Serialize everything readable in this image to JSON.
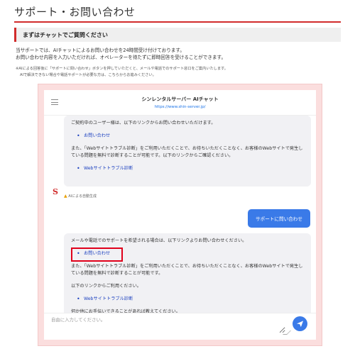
{
  "page": {
    "title": "サポート・お問い合わせ",
    "section_heading": "まずはチャットでご質問ください",
    "intro_line1": "当サポートでは、AIチャットによるお問い合わせを24時間受け付けております。",
    "intro_line2": "お問い合わせ内容を入力いただければ、オペレーターを待たずに即時回答を受けることができます。",
    "note_line1": "※AIによる回答後に「サポートに問い合わせ」ボタンを押していただくと、メールや電話でのサポート窓口をご案内いたします。",
    "note_line2": "AIで解決できない場合や電話サポートが必要な方は、こちらからお進みください。"
  },
  "chat": {
    "title": "シンレンタルサーバー AIチャット",
    "url": "https://www.shin-server.jp/",
    "message1": {
      "p1": "ご契約中のユーザー様は、以下のリンクからお問い合わせいただけます。",
      "link1": "お問い合わせ",
      "p2": "また、「Webサイトトラブル診断」をご利用いただくことで、お待ちいただくことなく、お客様のWebサイトで発生している問題を無料で診断することが可能です。以下のリンクからご確認ください。",
      "link2": "Webサイトトラブル診断"
    },
    "ai_note": "AIによる自動生成",
    "ai_note_icon": "warning-icon",
    "user_message": "サポートに問い合わせ",
    "message2": {
      "p1": "メールや電話でのサポートを希望される場合は、以下リンクよりお問い合わせください。",
      "link1": "お問い合わせ",
      "p2": "また、「Webサイトトラブル診断」をご利用いただくことで、お待ちいただくことなく、お客様のWebサイトで発生している問題を無料で診断することが可能です。",
      "p3": "以下のリンクからご利用ください。",
      "link2": "Webサイトトラブル診断",
      "p4": "何か他にお手伝いできることがあれば教えてください。"
    },
    "bot_logo": "S",
    "input_placeholder": "自由に入力してください。",
    "send_icon": "send-icon"
  },
  "colors": {
    "accent_red": "#d12b2b",
    "button_blue": "#3a7ae8",
    "link_blue": "#1a3fbf",
    "frame_pink": "#fbdede",
    "highlight_red": "#e0001b"
  }
}
